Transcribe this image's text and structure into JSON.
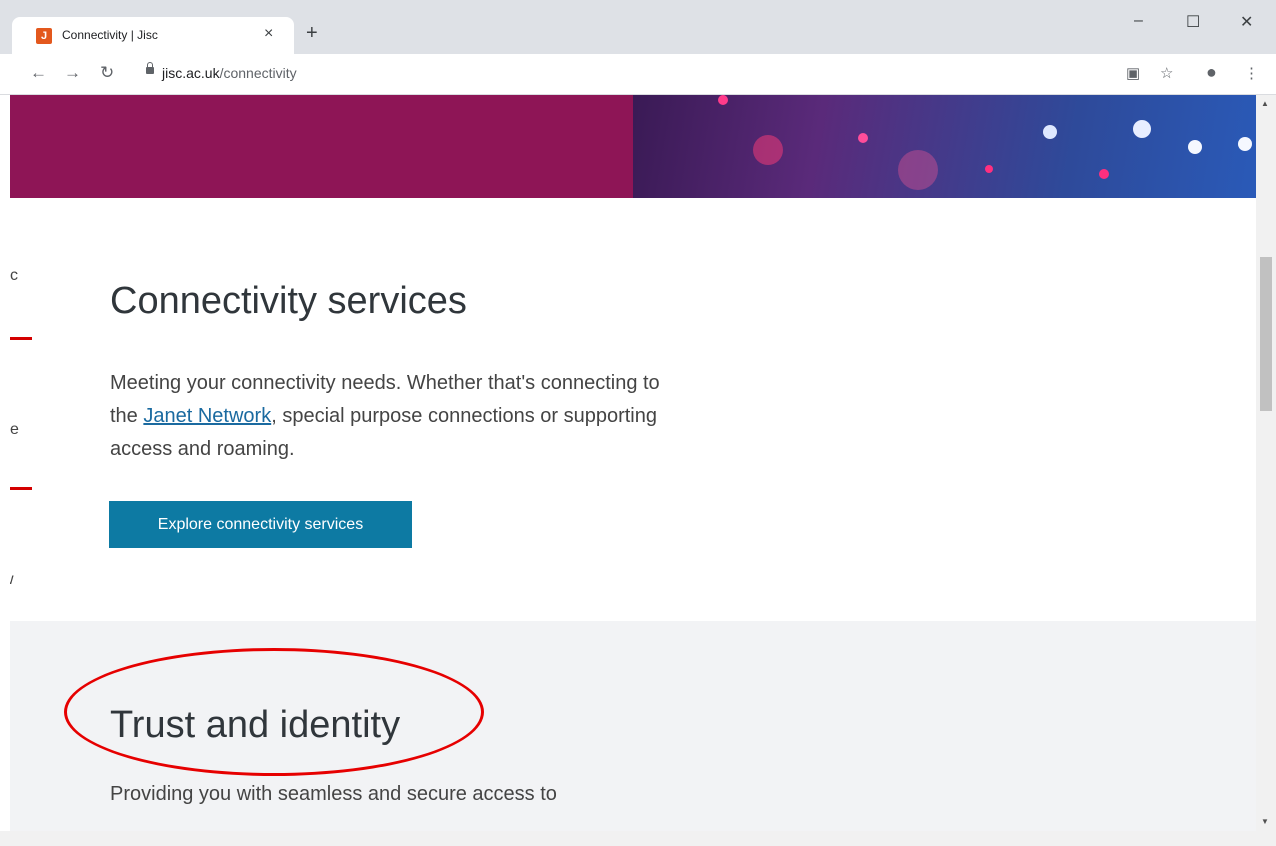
{
  "browser": {
    "tab_title": "Connectivity | Jisc",
    "favicon_letter": "J",
    "new_tab_glyph": "+",
    "close_glyph": "×",
    "url_domain": "jisc.ac.uk",
    "url_path": "/connectivity",
    "win_min": "–",
    "win_max": "☐",
    "win_close": "✕"
  },
  "page": {
    "side_snippets": [
      "cc",
      "ce",
      "w"
    ],
    "section1": {
      "title": "Connectivity services",
      "text_before_link": "Meeting your connectivity needs. Whether that's connecting to the ",
      "link_text": "Janet Network",
      "text_after_link": ", special purpose connections or supporting access and roaming.",
      "button_label": "Explore connectivity services"
    },
    "section2": {
      "title": "Trust and identity",
      "text": "Providing you with seamless and secure access to"
    }
  },
  "colors": {
    "hero": "#8e1556",
    "button": "#0d7aa3",
    "annotation": "#e60000"
  }
}
